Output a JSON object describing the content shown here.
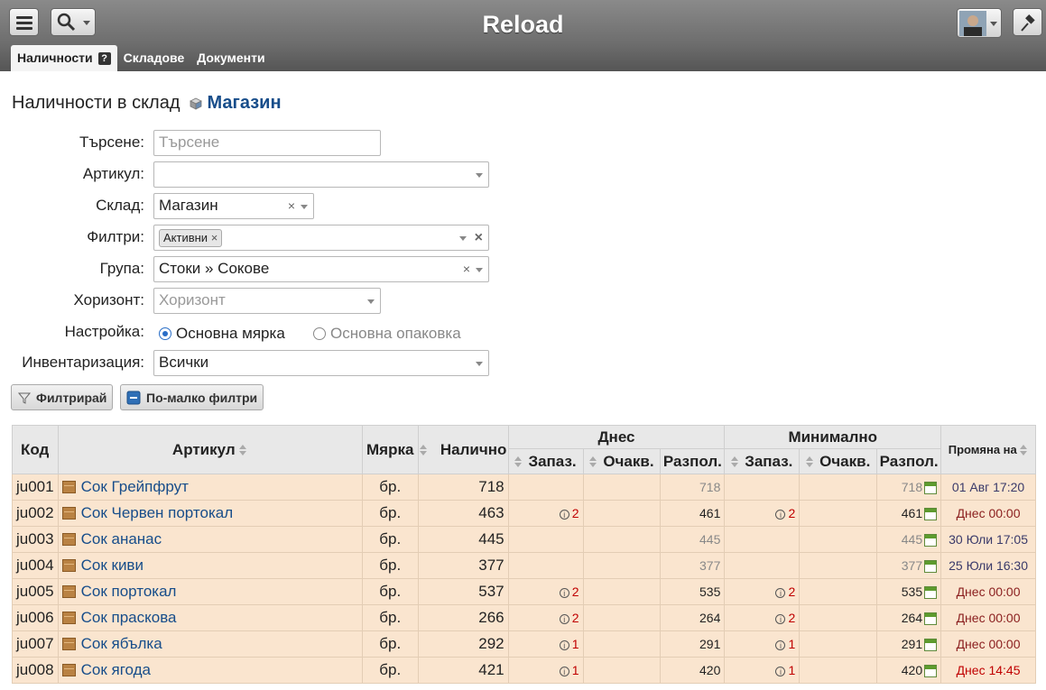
{
  "app": {
    "title": "Reload"
  },
  "tabs": [
    {
      "label": "Наличности",
      "active": true
    },
    {
      "label": "Складове",
      "active": false
    },
    {
      "label": "Документи",
      "active": false
    }
  ],
  "page": {
    "heading_prefix": "Наличности в склад",
    "heading_store": "Магазин"
  },
  "form": {
    "search": {
      "label": "Търсене:",
      "placeholder": "Търсене"
    },
    "article": {
      "label": "Артикул:",
      "value": ""
    },
    "warehouse": {
      "label": "Склад:",
      "value": "Магазин"
    },
    "filters": {
      "label": "Филтри:",
      "chip": "Активни"
    },
    "group": {
      "label": "Група:",
      "value": "Стоки » Сокове"
    },
    "horizon": {
      "label": "Хоризонт:",
      "placeholder": "Хоризонт"
    },
    "setting": {
      "label": "Настройка:",
      "option1": "Основна мярка",
      "option2": "Основна опаковка",
      "selected": "Основна мярка"
    },
    "inventory": {
      "label": "Инвентаризация:",
      "value": "Всички"
    }
  },
  "buttons": {
    "filter": "Филтрирай",
    "fewer_filters": "По-малко филтри"
  },
  "table": {
    "headers": {
      "code": "Код",
      "article": "Артикул",
      "unit": "Мярка",
      "available": "Налично",
      "today": "Днес",
      "minimum": "Минимално",
      "reserved": "Запаз.",
      "expected": "Очакв.",
      "free": "Разпол.",
      "changed": "Промяна на"
    },
    "rows": [
      {
        "code": "ju001",
        "name": "Сок Грейпфрут",
        "unit": "бр.",
        "qty": "718",
        "t_res": "",
        "t_exp": "",
        "t_free": "718",
        "m_res": "",
        "m_exp": "",
        "m_free": "718",
        "date": "01 Авг 17:20",
        "dim": true
      },
      {
        "code": "ju002",
        "name": "Сок Червен портокал",
        "unit": "бр.",
        "qty": "463",
        "t_res": "2",
        "t_exp": "",
        "t_free": "461",
        "m_res": "2",
        "m_exp": "",
        "m_free": "461",
        "date": "Днес 00:00",
        "dim": false
      },
      {
        "code": "ju003",
        "name": "Сок ананас",
        "unit": "бр.",
        "qty": "445",
        "t_res": "",
        "t_exp": "",
        "t_free": "445",
        "m_res": "",
        "m_exp": "",
        "m_free": "445",
        "date": "30 Юли 17:05",
        "dim": true
      },
      {
        "code": "ju004",
        "name": "Сок киви",
        "unit": "бр.",
        "qty": "377",
        "t_res": "",
        "t_exp": "",
        "t_free": "377",
        "m_res": "",
        "m_exp": "",
        "m_free": "377",
        "date": "25 Юли 16:30",
        "dim": true
      },
      {
        "code": "ju005",
        "name": "Сок портокал",
        "unit": "бр.",
        "qty": "537",
        "t_res": "2",
        "t_exp": "",
        "t_free": "535",
        "m_res": "2",
        "m_exp": "",
        "m_free": "535",
        "date": "Днес 00:00",
        "dim": false
      },
      {
        "code": "ju006",
        "name": "Сок праскова",
        "unit": "бр.",
        "qty": "266",
        "t_res": "2",
        "t_exp": "",
        "t_free": "264",
        "m_res": "2",
        "m_exp": "",
        "m_free": "264",
        "date": "Днес 00:00",
        "dim": false
      },
      {
        "code": "ju007",
        "name": "Сок ябълка",
        "unit": "бр.",
        "qty": "292",
        "t_res": "1",
        "t_exp": "",
        "t_free": "291",
        "m_res": "1",
        "m_exp": "",
        "m_free": "291",
        "date": "Днес 00:00",
        "dim": false
      },
      {
        "code": "ju008",
        "name": "Сок ягода",
        "unit": "бр.",
        "qty": "421",
        "t_res": "1",
        "t_exp": "",
        "t_free": "420",
        "m_res": "1",
        "m_exp": "",
        "m_free": "420",
        "date": "Днес 14:45",
        "dim": false
      }
    ]
  },
  "icons": {
    "menu": "hamburger-icon",
    "search": "magnifier-icon",
    "user": "avatar-icon",
    "pin": "pin-icon",
    "help": "help-icon",
    "store": "cube-icon",
    "product": "box-icon",
    "info": "info-icon",
    "calendar": "calendar-icon"
  },
  "colors": {
    "row_bg": "#fae5cf",
    "link": "#174d8a",
    "alert": "#c00000"
  }
}
